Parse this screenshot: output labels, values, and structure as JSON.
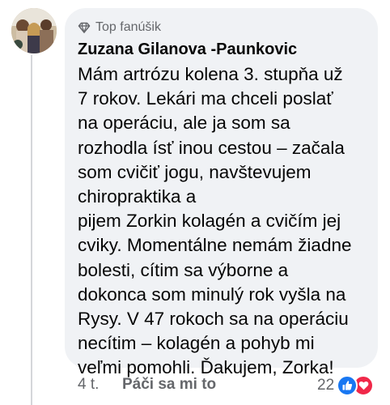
{
  "comment": {
    "badge_label": "Top fanúšik",
    "author_name": "Zuzana Gilanova -Paunkovic",
    "text_lines": [
      "Mám artrózu kolena 3. stupňa už",
      "7 rokov. Lekári ma chceli poslať",
      "na operáciu, ale ja som sa",
      "rozhodla ísť inou cestou – začala",
      "som cvičiť jogu, navštevujem",
      "chiropraktika a",
      "pijem Zorkin kolagén a cvičím jej",
      "cviky. Momentálne nemám žiadne",
      "bolesti, cítim sa výborne a",
      "dokonca som minulý rok vyšla na",
      "Rysy. V 47 rokoch sa na operáciu",
      "necítim – kolagén a pohyb mi",
      "veľmi pomohli. Ďakujem, Zorka!"
    ]
  },
  "footer": {
    "time": "4 t.",
    "like_label": "Páči sa mi to",
    "reaction_count": "22"
  },
  "icons": {
    "badge": "diamond-icon",
    "reaction_like": "thumbs-up-icon",
    "reaction_love": "heart-icon"
  },
  "colors": {
    "bubble_background": "#f0f2f5",
    "secondary_text": "#65676b",
    "primary_text": "#050505",
    "like_blue": "#1877f2",
    "love_red": "#f02849"
  }
}
